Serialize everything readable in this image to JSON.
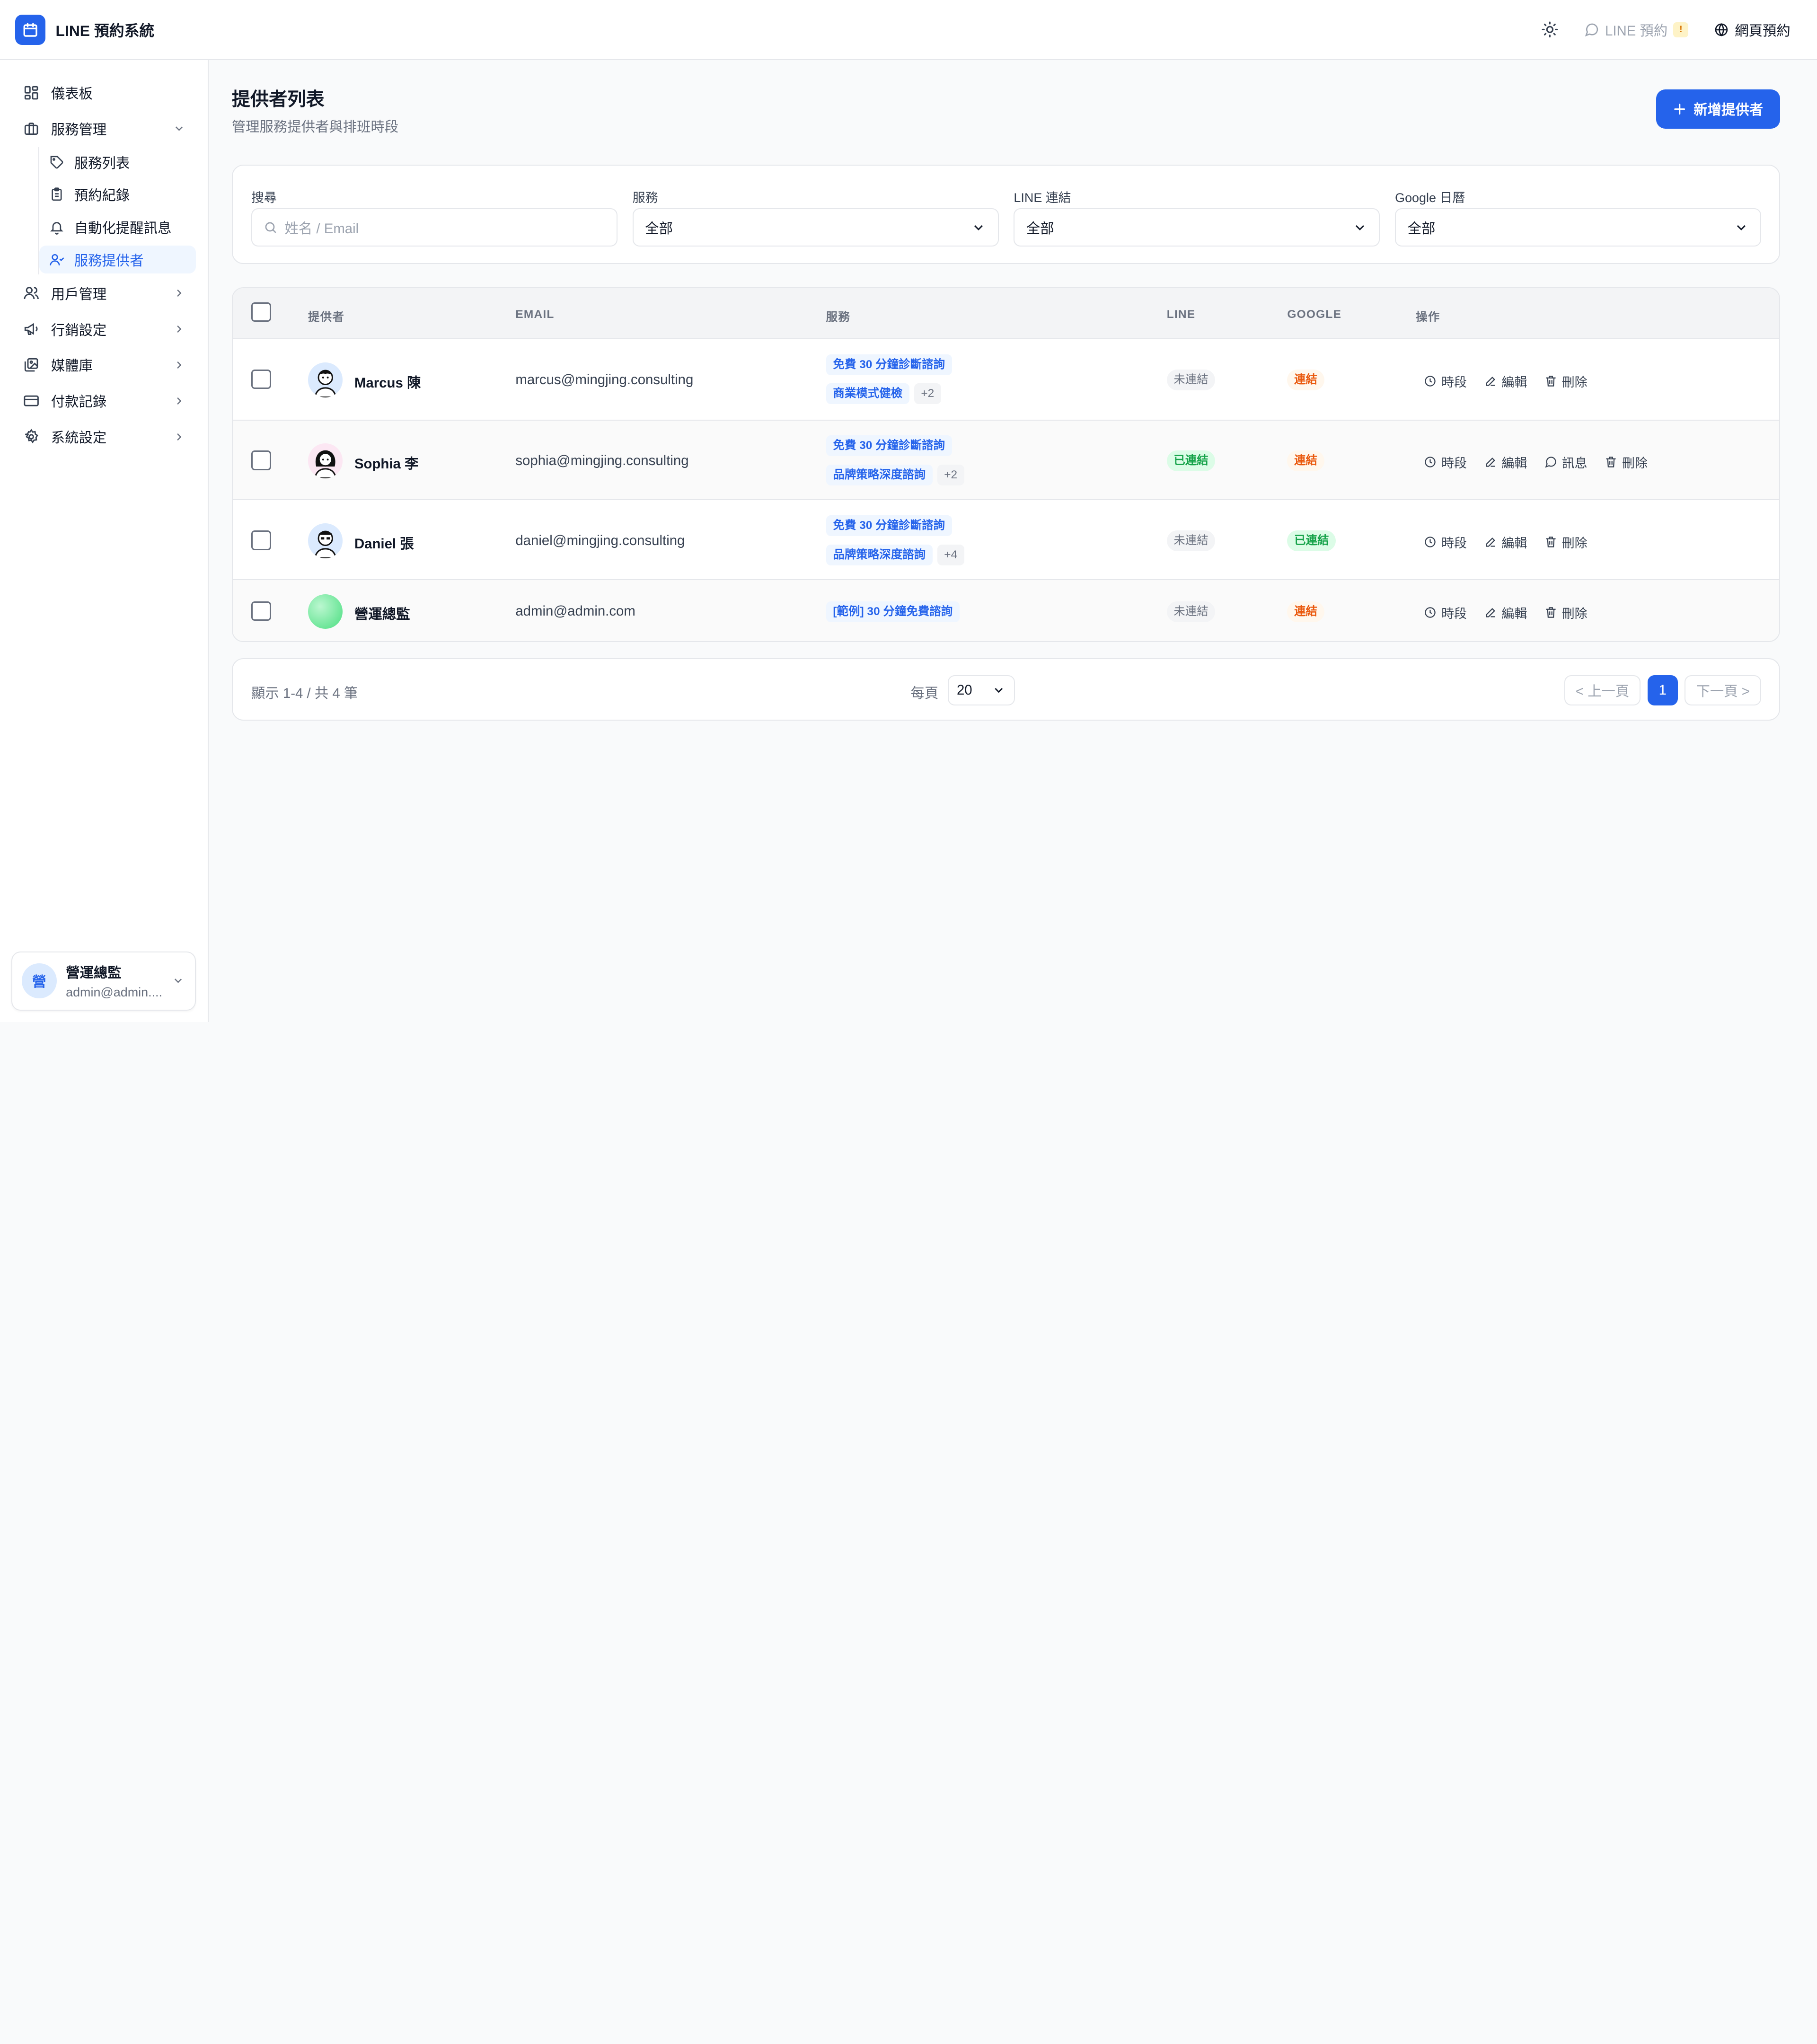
{
  "app": {
    "title": "LINE 預約系統"
  },
  "header": {
    "line_booking": "LINE 預約",
    "warn_badge": "!",
    "web_booking": "網頁預約"
  },
  "sidebar": {
    "items": [
      {
        "label": "儀表板"
      },
      {
        "label": "服務管理"
      },
      {
        "label": "用戶管理"
      },
      {
        "label": "行銷設定"
      },
      {
        "label": "媒體庫"
      },
      {
        "label": "付款記錄"
      },
      {
        "label": "系統設定"
      }
    ],
    "sub_items": [
      {
        "label": "服務列表"
      },
      {
        "label": "預約紀錄"
      },
      {
        "label": "自動化提醒訊息"
      },
      {
        "label": "服務提供者"
      }
    ],
    "user": {
      "avatar": "營",
      "name": "營運總監",
      "email": "admin@admin...."
    }
  },
  "page": {
    "title": "提供者列表",
    "subtitle": "管理服務提供者與排班時段",
    "add_button": "新增提供者"
  },
  "filters": {
    "search": {
      "label": "搜尋",
      "placeholder": "姓名 / Email"
    },
    "service": {
      "label": "服務",
      "value": "全部"
    },
    "line": {
      "label": "LINE 連結",
      "value": "全部"
    },
    "google": {
      "label": "Google 日曆",
      "value": "全部"
    }
  },
  "table": {
    "headers": [
      "提供者",
      "EMAIL",
      "服務",
      "LINE",
      "GOOGLE",
      "操作"
    ],
    "rows": [
      {
        "name": "Marcus 陳",
        "email": "marcus@mingjing.consulting",
        "tag1": "免費 30 分鐘診斷諮詢",
        "tag2": "商業模式健檢",
        "more": "+2",
        "line": "未連結",
        "google": "連結",
        "actions": [
          "時段",
          "編輯",
          "刪除"
        ]
      },
      {
        "name": "Sophia 李",
        "email": "sophia@mingjing.consulting",
        "tag1": "免費 30 分鐘診斷諮詢",
        "tag2": "品牌策略深度諮詢",
        "more": "+2",
        "line": "已連結",
        "google": "連結",
        "actions": [
          "時段",
          "編輯",
          "訊息",
          "刪除"
        ]
      },
      {
        "name": "Daniel 張",
        "email": "daniel@mingjing.consulting",
        "tag1": "免費 30 分鐘診斷諮詢",
        "tag2": "品牌策略深度諮詢",
        "more": "+4",
        "line": "未連結",
        "google": "已連結",
        "actions": [
          "時段",
          "編輯",
          "刪除"
        ]
      },
      {
        "name": "營運總監",
        "email": "admin@admin.com",
        "tag1": "[範例] 30 分鐘免費諮詢",
        "line": "未連結",
        "google": "連結",
        "actions": [
          "時段",
          "編輯",
          "刪除"
        ]
      }
    ]
  },
  "pagination": {
    "info": "顯示 1-4 / 共 4 筆",
    "per_page_label": "每頁",
    "per_page_value": "20",
    "prev": "< 上一頁",
    "current": "1",
    "next": "下一頁 >"
  },
  "colors": {
    "primary": "#2563eb",
    "connected_green": "#16a34a",
    "link_orange": "#ea580c",
    "muted_gray": "#6b7280"
  }
}
